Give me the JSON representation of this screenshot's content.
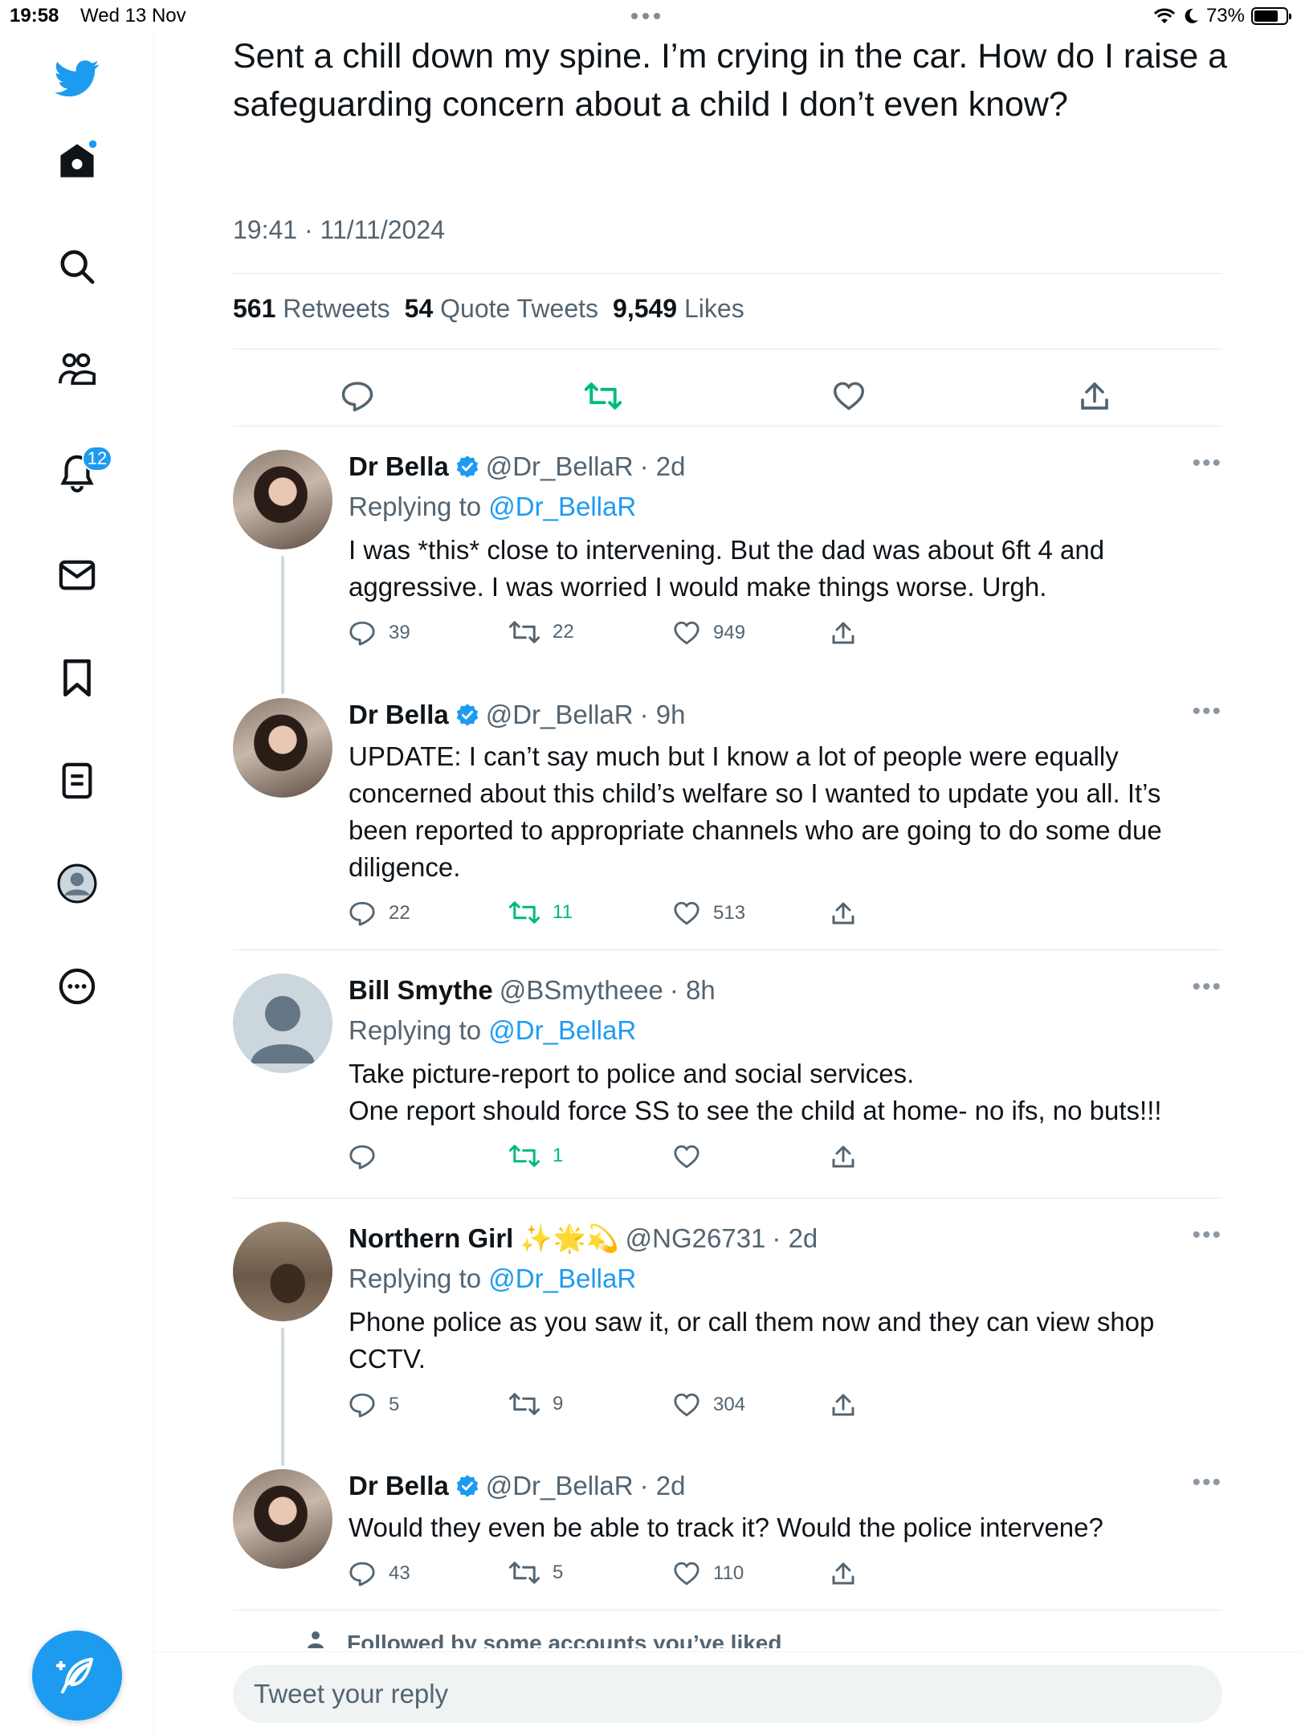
{
  "status_bar": {
    "time": "19:58",
    "date": "Wed 13 Nov",
    "battery": "73%"
  },
  "sidebar": {
    "notifications_badge": "12"
  },
  "tweet": {
    "text": "Sent a chill down my spine. I’m crying in the car. How do I raise a safeguarding concern about a child I don’t even know?",
    "timestamp": "19:41 · 11/11/2024",
    "stats": {
      "retweets": "561",
      "retweets_label": "Retweets",
      "quotes": "54",
      "quotes_label": "Quote Tweets",
      "likes": "9,549",
      "likes_label": "Likes"
    }
  },
  "replies": [
    {
      "name": "Dr Bella",
      "handle": "@Dr_BellaR",
      "time": "· 2d",
      "replying_prefix": "Replying to",
      "replying_to": "@Dr_BellaR",
      "text": "I was *this* close to intervening. But the dad was about 6ft 4 and aggressive. I was worried I would make things worse. Urgh.",
      "comments": "39",
      "retweets": "22",
      "likes": "949"
    },
    {
      "name": "Dr Bella",
      "handle": "@Dr_BellaR",
      "time": "· 9h",
      "text": "UPDATE: I can’t say much but I know a lot of people were equally concerned about this child’s welfare so I wanted to update you all. It’s been reported to appropriate channels who are going to do some due diligence.",
      "comments": "22",
      "retweets": "11",
      "likes": "513"
    },
    {
      "name": "Bill Smythe",
      "handle": "@BSmytheee",
      "time": "· 8h",
      "replying_prefix": "Replying to",
      "replying_to": "@Dr_BellaR",
      "text": "Take picture-report to police and social services.",
      "text2": "One report should force SS to see the child at home- no ifs, no buts!!!",
      "comments": "",
      "retweets": "1",
      "likes": ""
    },
    {
      "name": "Northern Girl",
      "emoji": "✨🌟💫",
      "handle": "@NG26731",
      "time": "· 2d",
      "replying_prefix": "Replying to",
      "replying_to": "@Dr_BellaR",
      "text": "Phone police as you saw it, or call them now and they can view shop CCTV.",
      "comments": "5",
      "retweets": "9",
      "likes": "304"
    },
    {
      "name": "Dr Bella",
      "handle": "@Dr_BellaR",
      "time": "· 2d",
      "text": "Would they even be able to track it? Would the police intervene?",
      "comments": "43",
      "retweets": "5",
      "likes": "110"
    }
  ],
  "followed_note": "Followed by some accounts you’ve liked",
  "reply_box": {
    "placeholder": "Tweet your reply"
  },
  "colors": {
    "accent": "#1d9bf0",
    "retweet_green": "#00ba7c",
    "text": "#0f1419",
    "muted": "#536471"
  }
}
